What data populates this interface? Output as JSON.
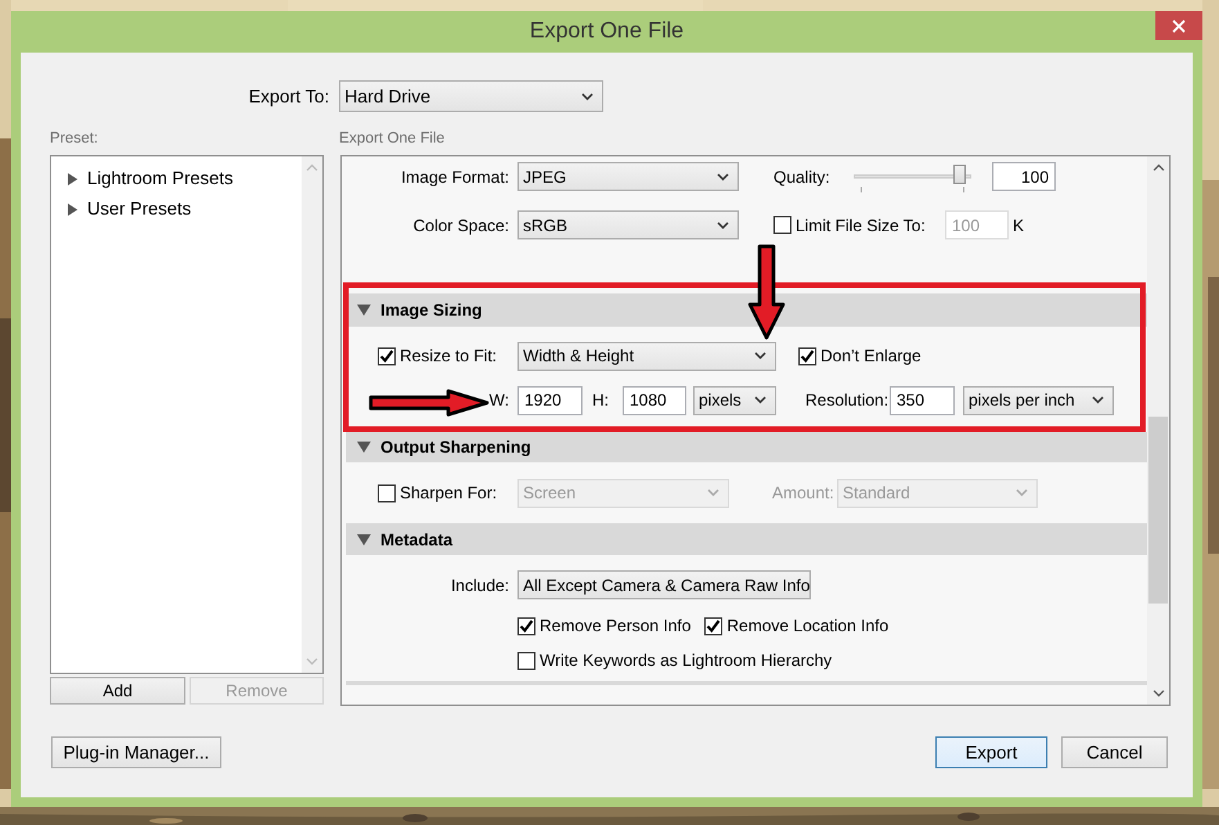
{
  "window": {
    "title": "Export One File"
  },
  "export_to": {
    "label": "Export To:",
    "value": "Hard Drive"
  },
  "preset_panel": {
    "label": "Preset:",
    "items": [
      {
        "label": "Lightroom Presets",
        "expanded": false
      },
      {
        "label": "User Presets",
        "expanded": false
      }
    ],
    "buttons": [
      {
        "label": "Add",
        "disabled": false
      },
      {
        "label": "Remove",
        "disabled": true
      }
    ]
  },
  "settings_panel": {
    "label": "Export One File",
    "file_settings": {
      "image_format": {
        "label": "Image Format:",
        "value": "JPEG"
      },
      "quality": {
        "label": "Quality:",
        "level": 0.95,
        "value": "100"
      },
      "color_space": {
        "label": "Color Space:",
        "value": "sRGB"
      },
      "limit_file_size": {
        "label": "Limit File Size To:",
        "checked": false,
        "value": "100",
        "unit": "K"
      }
    },
    "image_sizing": {
      "title": "Image Sizing",
      "expanded": true,
      "resize_to_fit": {
        "label": "Resize to Fit:",
        "checked": true,
        "value": "Width & Height"
      },
      "dont_enlarge": {
        "label": "Don’t Enlarge",
        "checked": true
      },
      "width": {
        "label": "W:",
        "value": "1920"
      },
      "height": {
        "label": "H:",
        "value": "1080"
      },
      "size_unit": "pixels",
      "resolution": {
        "label": "Resolution:",
        "value": "350",
        "unit": "pixels per inch"
      }
    },
    "output_sharpening": {
      "title": "Output Sharpening",
      "expanded": true,
      "sharpen_for": {
        "label": "Sharpen For:",
        "checked": false,
        "value": "Screen"
      },
      "amount": {
        "label": "Amount:",
        "value": "Standard"
      }
    },
    "metadata": {
      "title": "Metadata",
      "expanded": true,
      "include": {
        "label": "Include:",
        "value": "All Except Camera & Camera Raw Info"
      },
      "options": [
        {
          "label": "Remove Person Info",
          "checked": true
        },
        {
          "label": "Remove Location Info",
          "checked": true
        },
        {
          "label": "Write Keywords as Lightroom Hierarchy",
          "checked": false
        }
      ]
    }
  },
  "footer_buttons": [
    {
      "label": "Plug-in Manager...",
      "default": false
    },
    {
      "label": "Export",
      "default": true
    },
    {
      "label": "Cancel",
      "default": false
    }
  ]
}
